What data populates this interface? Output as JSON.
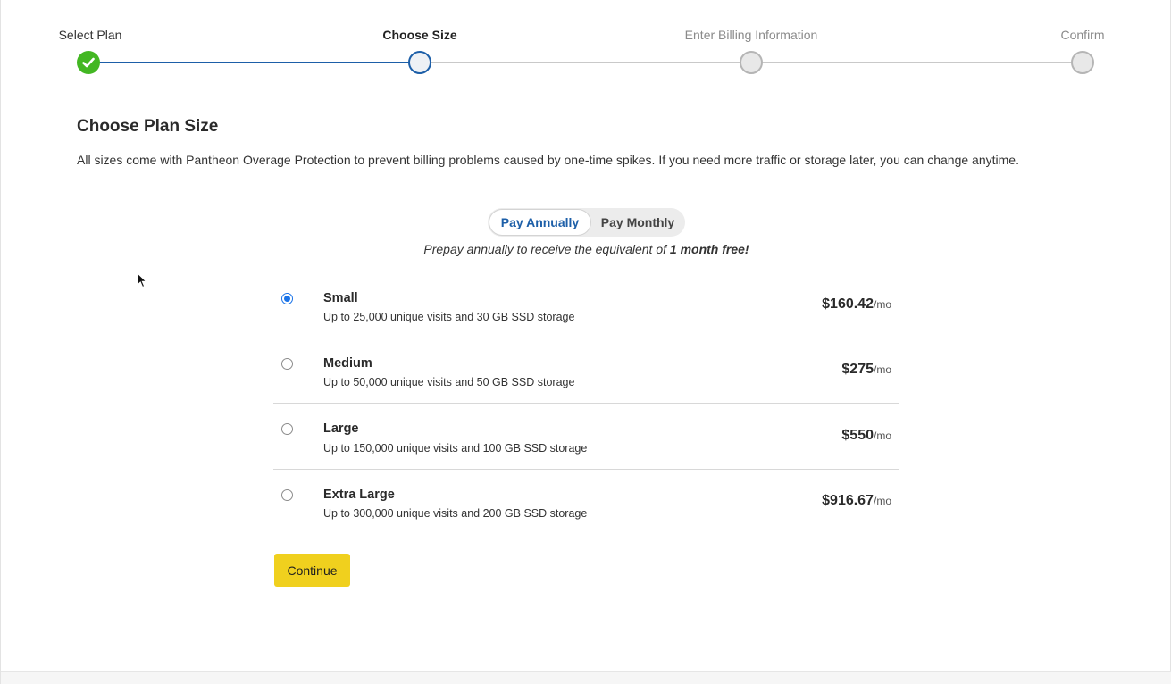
{
  "stepper": {
    "steps": [
      {
        "label": "Select Plan",
        "state": "completed"
      },
      {
        "label": "Choose Size",
        "state": "active"
      },
      {
        "label": "Enter Billing Information",
        "state": "pending"
      },
      {
        "label": "Confirm",
        "state": "pending"
      }
    ]
  },
  "main": {
    "title": "Choose Plan Size",
    "description": "All sizes come with Pantheon Overage Protection to prevent billing problems caused by one-time spikes. If you need more traffic or storage later, you can change anytime."
  },
  "billing_toggle": {
    "options": [
      "Pay Annually",
      "Pay Monthly"
    ],
    "selected": "Pay Annually",
    "promo_prefix": "Prepay annually to receive the equivalent of ",
    "promo_emphasis": "1 month free!"
  },
  "plans": [
    {
      "name": "Small",
      "detail": "Up to 25,000 unique visits and 30 GB SSD storage",
      "price": "$160.42",
      "unit": "/mo",
      "selected": true
    },
    {
      "name": "Medium",
      "detail": "Up to 50,000 unique visits and 50 GB SSD storage",
      "price": "$275",
      "unit": "/mo",
      "selected": false
    },
    {
      "name": "Large",
      "detail": "Up to 150,000 unique visits and 100 GB SSD storage",
      "price": "$550",
      "unit": "/mo",
      "selected": false
    },
    {
      "name": "Extra Large",
      "detail": "Up to 300,000 unique visits and 200 GB SSD storage",
      "price": "$916.67",
      "unit": "/mo",
      "selected": false
    }
  ],
  "actions": {
    "continue_label": "Continue"
  },
  "colors": {
    "accent": "#1d5fa8",
    "success": "#43b723",
    "button": "#f0d01e",
    "radio": "#1a73e8"
  }
}
